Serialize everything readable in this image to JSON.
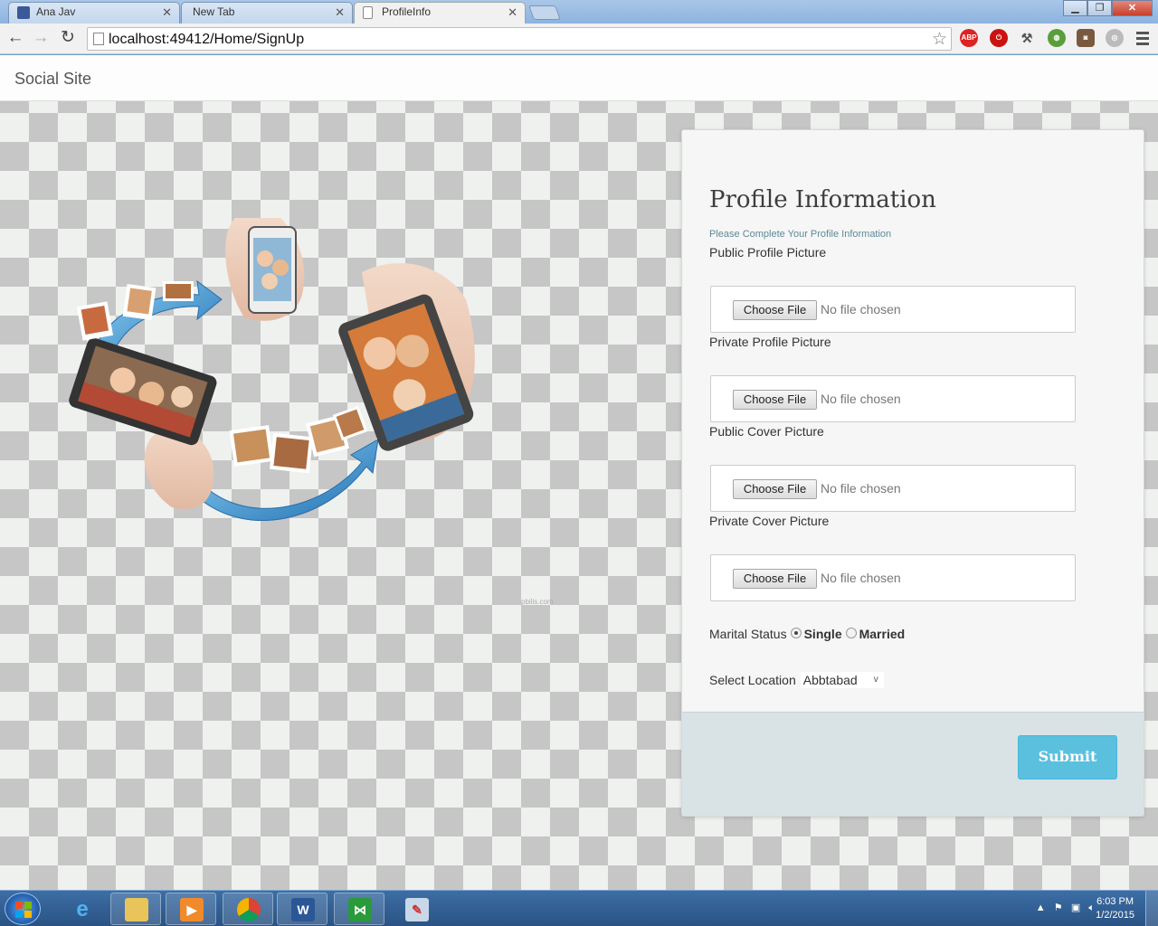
{
  "browser": {
    "tabs": [
      {
        "title": "Ana Jav",
        "favicon": "facebook-favicon"
      },
      {
        "title": "New Tab",
        "favicon": "none"
      },
      {
        "title": "ProfileInfo",
        "favicon": "page-favicon",
        "active": true
      }
    ],
    "address": "localhost:49412/Home/SignUp",
    "extensions": [
      "adblock-plus-icon",
      "stop-icon",
      "tools-icon",
      "globe-icon",
      "instagram-icon",
      "circle-icon"
    ]
  },
  "site": {
    "brand": "Social Site"
  },
  "illustration": {
    "watermark": "pbilis.com"
  },
  "form": {
    "title": "Profile Information",
    "subtitle": "Please Complete Your Profile Information",
    "fields": [
      {
        "label": "Public Profile Picture",
        "button": "Choose File",
        "status": "No file chosen"
      },
      {
        "label": "Private Profile Picture",
        "button": "Choose File",
        "status": "No file chosen"
      },
      {
        "label": "Public Cover Picture",
        "button": "Choose File",
        "status": "No file chosen"
      },
      {
        "label": "Private Cover Picture",
        "button": "Choose File",
        "status": "No file chosen"
      }
    ],
    "marital": {
      "label": "Marital Status",
      "options": [
        "Single",
        "Married"
      ],
      "selected": "Single"
    },
    "location": {
      "label": "Select Location",
      "value": "Abbtabad"
    },
    "submit": "Submit"
  },
  "taskbar": {
    "time": "6:03 PM",
    "date": "1/2/2015",
    "apps": [
      "internet-explorer-icon",
      "file-explorer-icon",
      "media-player-icon",
      "chrome-icon",
      "word-icon",
      "visual-studio-icon",
      "paint-icon"
    ]
  },
  "colors": {
    "accent": "#5bc0de",
    "subtitle": "#5f8a99",
    "checker_dark": "#c6c6c6",
    "checker_light": "#eff1ef"
  }
}
